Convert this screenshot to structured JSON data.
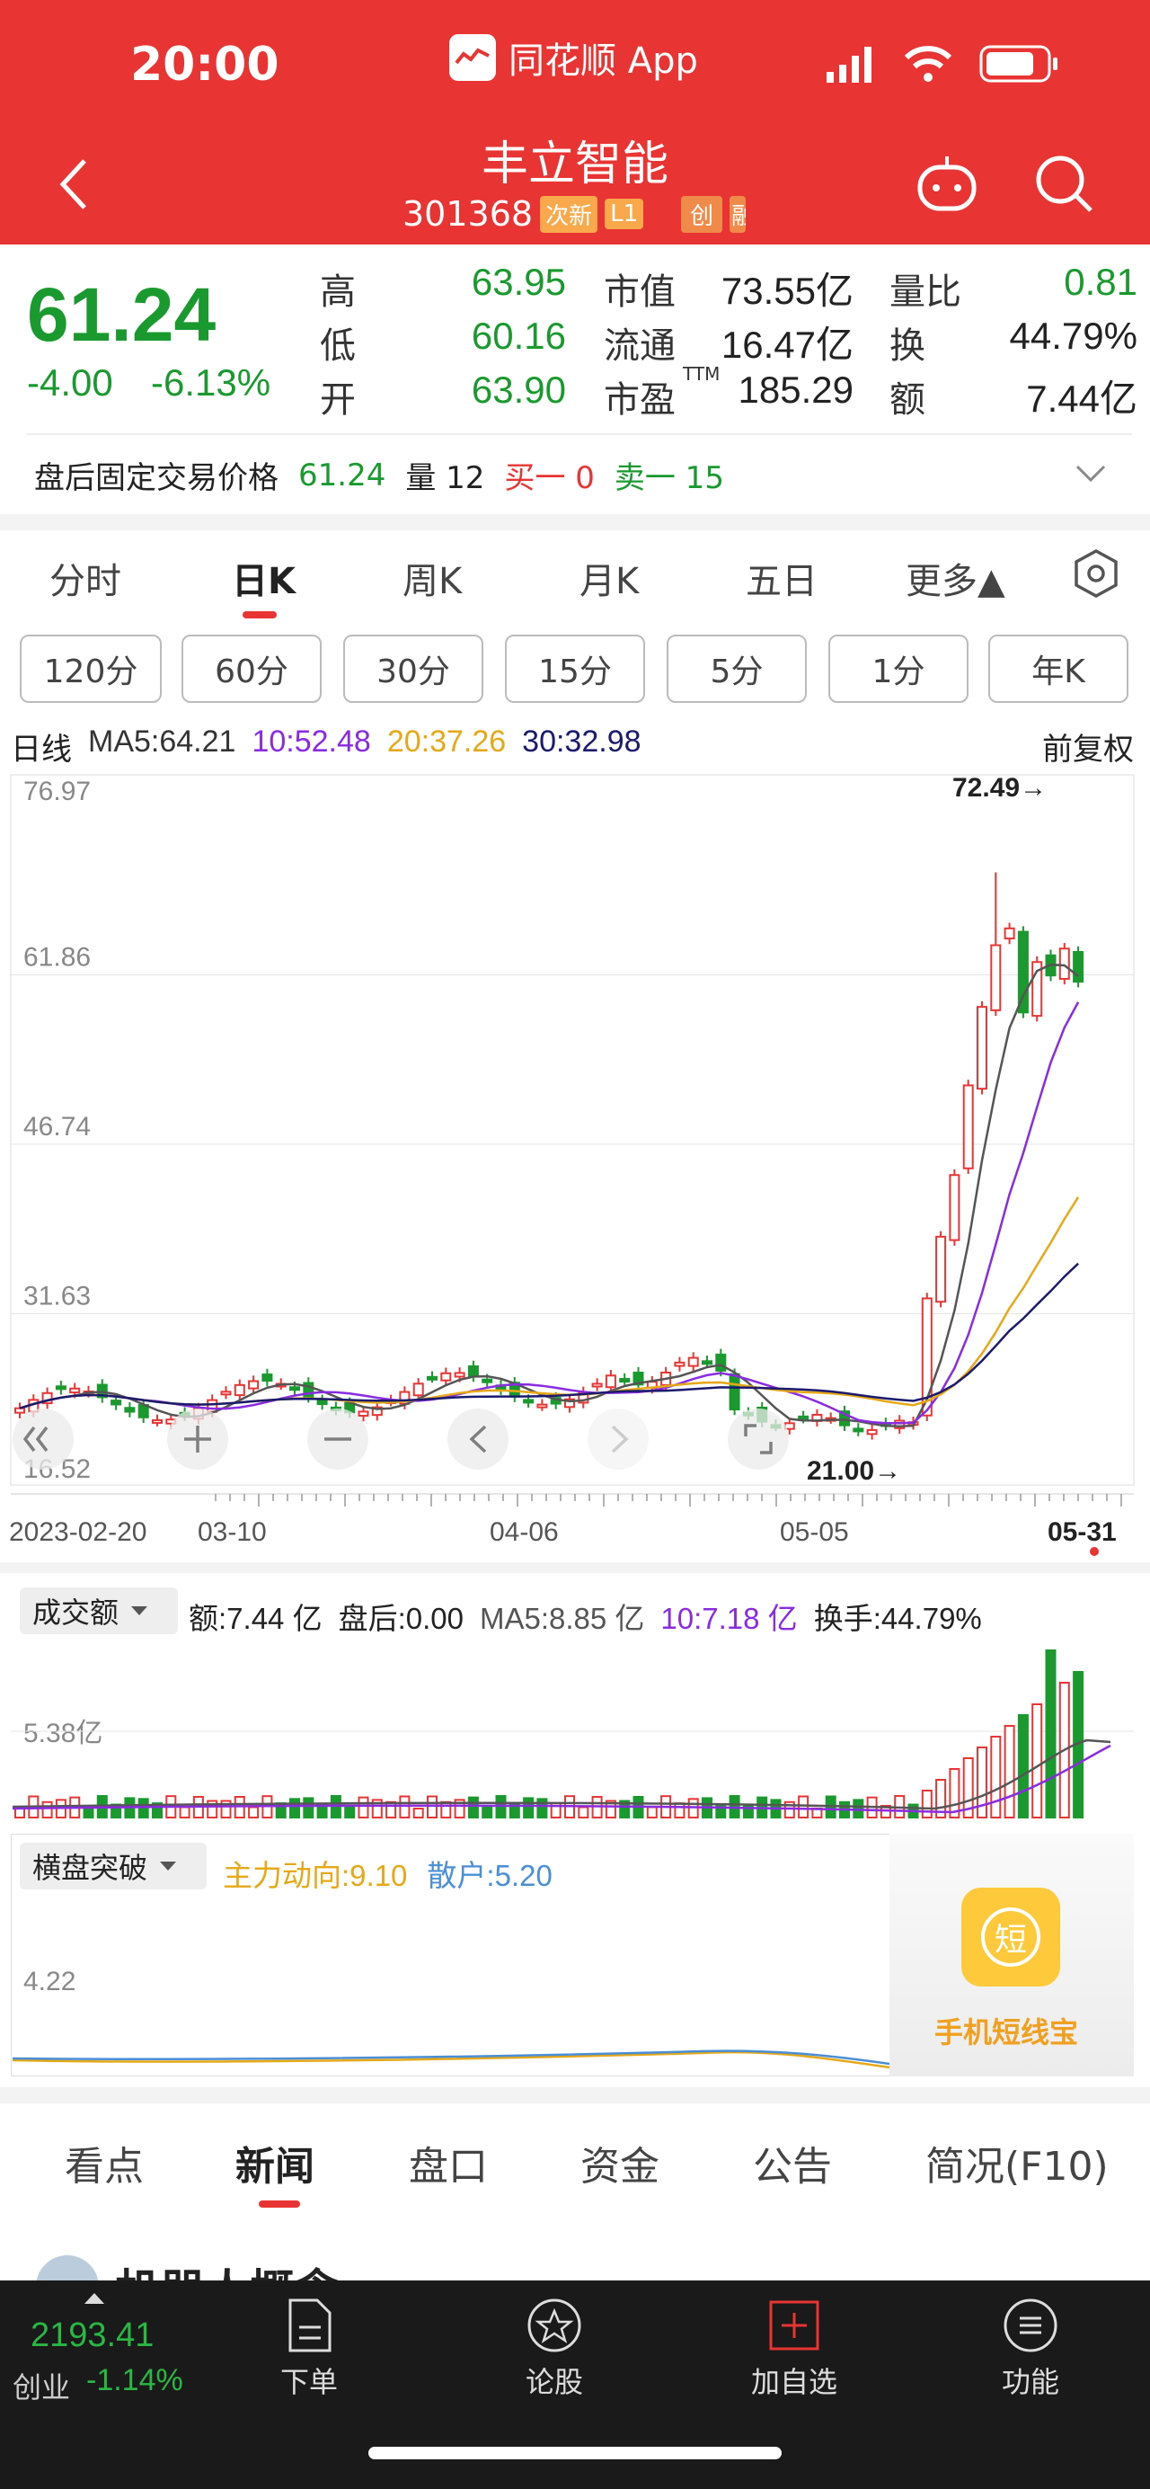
{
  "status_bar": {
    "time": "20:00",
    "app_name": "同花顺 App"
  },
  "stock": {
    "name": "丰立智能",
    "code": "301368",
    "tag1": "次新",
    "tag2": "L1",
    "tag3": "创",
    "tag4": "融"
  },
  "quote": {
    "price": "61.24",
    "change": "-4.00",
    "change_pct": "-6.13%",
    "high_label": "高",
    "high": "63.95",
    "low_label": "低",
    "low": "60.16",
    "open_label": "开",
    "open": "63.90",
    "mktcap_label": "市值",
    "mktcap": "73.55亿",
    "float_label": "流通",
    "float": "16.47亿",
    "pe_label": "市盈",
    "pe_sup": "TTM",
    "pe": "185.29",
    "vol_ratio_label": "量比",
    "vol_ratio": "0.81",
    "turnover_label": "换",
    "turnover": "44.79%",
    "amount_label": "额",
    "amount": "7.44亿"
  },
  "after_hours": {
    "label": "盘后固定交易价格",
    "price": "61.24",
    "vol_label": "量",
    "vol": "12",
    "buy": "买一 0",
    "sell": "卖一 15"
  },
  "tabs": [
    "分时",
    "日K",
    "周K",
    "月K",
    "五日",
    "更多▲"
  ],
  "periods": [
    "120分",
    "60分",
    "30分",
    "15分",
    "5分",
    "1分",
    "年K"
  ],
  "ma": {
    "label": "日线",
    "ma5": "MA5:64.21",
    "ma10": "10:52.48",
    "ma20": "20:37.26",
    "ma30": "30:32.98",
    "adjust": "前复权"
  },
  "kline": {
    "y_ticks": [
      "76.97",
      "61.86",
      "46.74",
      "31.63",
      "16.52"
    ],
    "x_ticks": [
      "2023-02-20",
      "03-10",
      "04-06",
      "05-05",
      "05-31"
    ],
    "high_label": "72.49→",
    "low_label": "21.00→"
  },
  "volume": {
    "selector": "成交额",
    "amount": "额:7.44 亿",
    "after": "盘后:0.00",
    "ma5": "MA5:8.85 亿",
    "ma10": "10:7.18 亿",
    "turnover": "换手:44.79%",
    "y_tick": "5.38亿"
  },
  "indicator": {
    "selector": "横盘突破",
    "main": "主力动向:9.10",
    "retail": "散户:5.20",
    "y_tick": "4.22"
  },
  "promo": {
    "label": "手机短线宝",
    "badge": "短"
  },
  "bottom_tabs": [
    "看点",
    "新闻",
    "盘口",
    "资金",
    "公告",
    "简况(F10)"
  ],
  "news_peek": "机器人概念",
  "toolbar": {
    "index_value": "2193.41",
    "index_name": "创业",
    "index_chg": "-1.14%",
    "items": [
      "下单",
      "论股",
      "加自选",
      "功能"
    ]
  },
  "colors": {
    "up": "#e93434",
    "down": "#1a9a2e",
    "ma5": "#555555",
    "ma10": "#8a2be2",
    "ma20": "#e6a817",
    "ma30": "#1a1a6e"
  }
}
